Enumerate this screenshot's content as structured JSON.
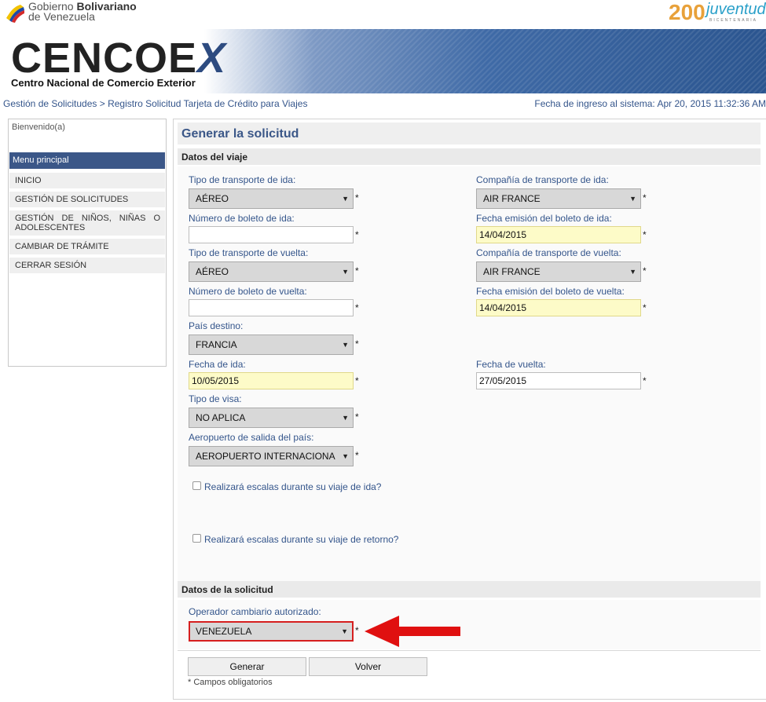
{
  "header": {
    "gov_line1_prefix": "Gobierno ",
    "gov_line1_bold": "Bolivariano",
    "gov_line2": "de Venezuela",
    "juv_number": "200",
    "juv_word": "juventud",
    "juv_sub": "BICENTENARIA",
    "logo_text": "CENCOE",
    "logo_x": "X",
    "logo_subtitle": "Centro Nacional de Comercio Exterior"
  },
  "breadcrumb": "Gestión de Solicitudes > Registro Solicitud Tarjeta de Crédito para Viajes",
  "fecha_ingreso": "Fecha de ingreso al sistema: Apr 20, 2015 11:32:36 AM",
  "sidebar": {
    "welcome": "Bienvenido(a)",
    "menu_title": "Menu principal",
    "items": [
      {
        "label": "INICIO"
      },
      {
        "label": "GESTIÓN DE SOLICITUDES"
      },
      {
        "label": "GESTIÓN DE NIÑOS, NIÑAS O ADOLESCENTES"
      },
      {
        "label": "CAMBIAR DE TRÁMITE"
      },
      {
        "label": "CERRAR SESIÓN"
      }
    ]
  },
  "main": {
    "title": "Generar la solicitud",
    "section_viaje": "Datos del viaje",
    "section_solicitud": "Datos de la solicitud",
    "fields": {
      "tipo_ida": {
        "label": "Tipo de transporte de ida:",
        "value": "AÉREO"
      },
      "compania_ida": {
        "label": "Compañía de transporte de ida:",
        "value": "AIR FRANCE"
      },
      "boleto_ida": {
        "label": "Número de boleto de ida:",
        "value": ""
      },
      "emision_ida": {
        "label": "Fecha emisión del boleto de ida:",
        "value": "14/04/2015"
      },
      "tipo_vuelta": {
        "label": "Tipo de transporte de vuelta:",
        "value": "AÉREO"
      },
      "compania_vuelta": {
        "label": "Compañía de transporte de vuelta:",
        "value": "AIR FRANCE"
      },
      "boleto_vuelta": {
        "label": "Número de boleto de vuelta:",
        "value": ""
      },
      "emision_vuelta": {
        "label": "Fecha emisión del boleto de vuelta:",
        "value": "14/04/2015"
      },
      "pais_destino": {
        "label": "País destino:",
        "value": "FRANCIA"
      },
      "fecha_ida": {
        "label": "Fecha de ida:",
        "value": "10/05/2015"
      },
      "fecha_vuelta": {
        "label": "Fecha de vuelta:",
        "value": "27/05/2015"
      },
      "tipo_visa": {
        "label": "Tipo de visa:",
        "value": "NO APLICA"
      },
      "aeropuerto": {
        "label": "Aeropuerto de salida del país:",
        "value": "AEROPUERTO INTERNACIONA"
      },
      "operador": {
        "label": "Operador cambiario autorizado:",
        "value": "VENEZUELA"
      }
    },
    "escalas_ida": "Realizará escalas durante su viaje de ida?",
    "escalas_retorno": "Realizará escalas durante su viaje de retorno?",
    "asterisk": "*",
    "btn_generar": "Generar",
    "btn_volver": "Volver",
    "required_note": "* Campos obligatorios"
  },
  "colors": {
    "accent": "#3b5788",
    "label": "#34558b",
    "highlight_field": "#fdfbc8",
    "arrow_red": "#e01010"
  }
}
